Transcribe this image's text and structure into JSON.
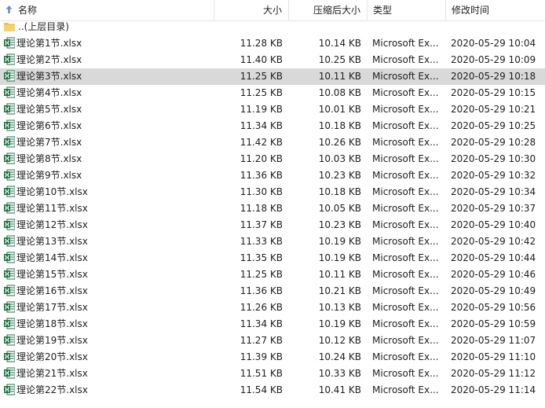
{
  "colors": {
    "selected_row": "#d9d9d9",
    "excel_green": "#1d7044",
    "folder_yellow": "#e8c14e"
  },
  "header": {
    "name": "名称",
    "size": "大小",
    "compressed": "压缩后大小",
    "type": "类型",
    "modified": "修改时间",
    "sort_icon": "sort-up-arrow-icon"
  },
  "parent_folder": {
    "label": "..(上层目录)",
    "icon": "folder-icon"
  },
  "files": [
    {
      "name": "理论第1节.xlsx",
      "size": "11.28 KB",
      "compressed": "10.14 KB",
      "type": "Microsoft Ex...",
      "modified": "2020-05-29 10:04",
      "selected": false
    },
    {
      "name": "理论第2节.xlsx",
      "size": "11.40 KB",
      "compressed": "10.25 KB",
      "type": "Microsoft Ex...",
      "modified": "2020-05-29 10:09",
      "selected": false
    },
    {
      "name": "理论第3节.xlsx",
      "size": "11.25 KB",
      "compressed": "10.11 KB",
      "type": "Microsoft Ex...",
      "modified": "2020-05-29 10:18",
      "selected": true
    },
    {
      "name": "理论第4节.xlsx",
      "size": "11.25 KB",
      "compressed": "10.08 KB",
      "type": "Microsoft Ex...",
      "modified": "2020-05-29 10:15",
      "selected": false
    },
    {
      "name": "理论第5节.xlsx",
      "size": "11.19 KB",
      "compressed": "10.01 KB",
      "type": "Microsoft Ex...",
      "modified": "2020-05-29 10:21",
      "selected": false
    },
    {
      "name": "理论第6节.xlsx",
      "size": "11.34 KB",
      "compressed": "10.18 KB",
      "type": "Microsoft Ex...",
      "modified": "2020-05-29 10:25",
      "selected": false
    },
    {
      "name": "理论第7节.xlsx",
      "size": "11.42 KB",
      "compressed": "10.26 KB",
      "type": "Microsoft Ex...",
      "modified": "2020-05-29 10:28",
      "selected": false
    },
    {
      "name": "理论第8节.xlsx",
      "size": "11.20 KB",
      "compressed": "10.03 KB",
      "type": "Microsoft Ex...",
      "modified": "2020-05-29 10:30",
      "selected": false
    },
    {
      "name": "理论第9节.xlsx",
      "size": "11.36 KB",
      "compressed": "10.23 KB",
      "type": "Microsoft Ex...",
      "modified": "2020-05-29 10:32",
      "selected": false
    },
    {
      "name": "理论第10节.xlsx",
      "size": "11.30 KB",
      "compressed": "10.18 KB",
      "type": "Microsoft Ex...",
      "modified": "2020-05-29 10:34",
      "selected": false
    },
    {
      "name": "理论第11节.xlsx",
      "size": "11.18 KB",
      "compressed": "10.05 KB",
      "type": "Microsoft Ex...",
      "modified": "2020-05-29 10:37",
      "selected": false
    },
    {
      "name": "理论第12节.xlsx",
      "size": "11.37 KB",
      "compressed": "10.23 KB",
      "type": "Microsoft Ex...",
      "modified": "2020-05-29 10:40",
      "selected": false
    },
    {
      "name": "理论第13节.xlsx",
      "size": "11.33 KB",
      "compressed": "10.19 KB",
      "type": "Microsoft Ex...",
      "modified": "2020-05-29 10:42",
      "selected": false
    },
    {
      "name": "理论第14节.xlsx",
      "size": "11.35 KB",
      "compressed": "10.19 KB",
      "type": "Microsoft Ex...",
      "modified": "2020-05-29 10:44",
      "selected": false
    },
    {
      "name": "理论第15节.xlsx",
      "size": "11.25 KB",
      "compressed": "10.11 KB",
      "type": "Microsoft Ex...",
      "modified": "2020-05-29 10:46",
      "selected": false
    },
    {
      "name": "理论第16节.xlsx",
      "size": "11.36 KB",
      "compressed": "10.21 KB",
      "type": "Microsoft Ex...",
      "modified": "2020-05-29 10:49",
      "selected": false
    },
    {
      "name": "理论第17节.xlsx",
      "size": "11.26 KB",
      "compressed": "10.13 KB",
      "type": "Microsoft Ex...",
      "modified": "2020-05-29 10:56",
      "selected": false
    },
    {
      "name": "理论第18节.xlsx",
      "size": "11.34 KB",
      "compressed": "10.19 KB",
      "type": "Microsoft Ex...",
      "modified": "2020-05-29 10:59",
      "selected": false
    },
    {
      "name": "理论第19节.xlsx",
      "size": "11.27 KB",
      "compressed": "10.12 KB",
      "type": "Microsoft Ex...",
      "modified": "2020-05-29 11:07",
      "selected": false
    },
    {
      "name": "理论第20节.xlsx",
      "size": "11.39 KB",
      "compressed": "10.24 KB",
      "type": "Microsoft Ex...",
      "modified": "2020-05-29 11:10",
      "selected": false
    },
    {
      "name": "理论第21节.xlsx",
      "size": "11.51 KB",
      "compressed": "10.33 KB",
      "type": "Microsoft Ex...",
      "modified": "2020-05-29 11:12",
      "selected": false
    },
    {
      "name": "理论第22节.xlsx",
      "size": "11.54 KB",
      "compressed": "10.41 KB",
      "type": "Microsoft Ex...",
      "modified": "2020-05-29 11:14",
      "selected": false
    }
  ]
}
